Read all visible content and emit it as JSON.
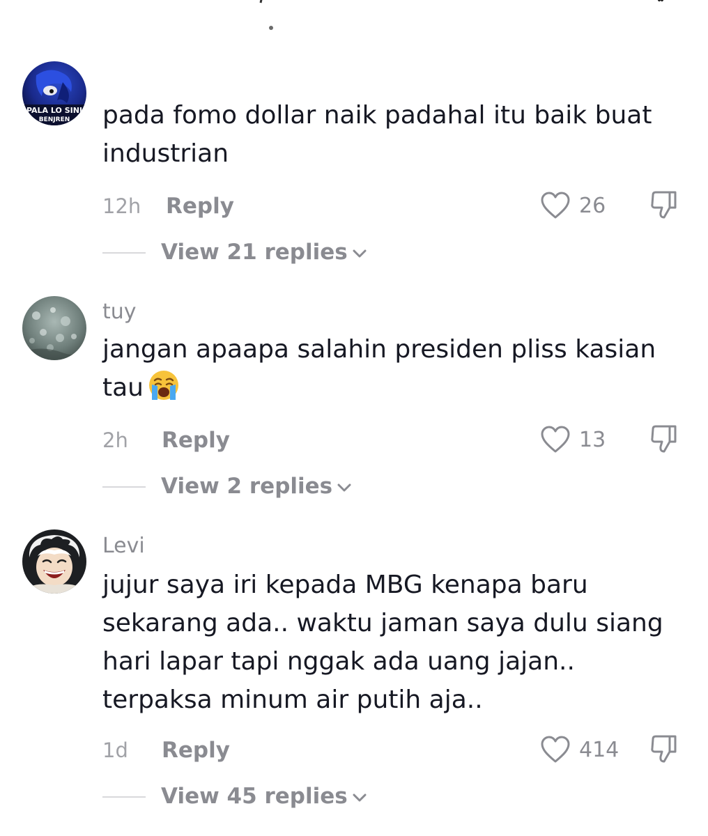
{
  "comments": [
    {
      "username": "",
      "avatar_icon": "sonic-avatar-icon",
      "avatar_caption": [
        "PALA LO SINI",
        "BENJREN"
      ],
      "lines": [
        "pada fomo dollar naik padahal itu baik buat",
        "industrian"
      ],
      "time": "12h",
      "reply_label": "Reply",
      "likes": "26",
      "view_replies": "View 21 replies"
    },
    {
      "username": "tuy",
      "avatar_icon": "stone-texture-avatar-icon",
      "lines": [
        "jangan apaapa salahin presiden pliss kasian",
        "tau"
      ],
      "emoji": "loudly-crying-face-icon",
      "time": "2h",
      "reply_label": "Reply",
      "likes": "13",
      "view_replies": "View 2 replies"
    },
    {
      "username": "Levi",
      "avatar_icon": "anime-character-avatar-icon",
      "lines": [
        "jujur saya iri kepada MBG kenapa baru",
        "sekarang ada.. waktu jaman saya dulu siang",
        "hari lapar tapi nggak ada uang jajan..",
        "terpaksa minum air putih aja.."
      ],
      "time": "1d",
      "reply_label": "Reply",
      "likes": "414",
      "view_replies": "View 45 replies"
    }
  ],
  "colors": {
    "text": "#161823",
    "secondary": "#8a8b91",
    "timestamp": "#a1a2a7",
    "divider": "#d8d8db"
  }
}
